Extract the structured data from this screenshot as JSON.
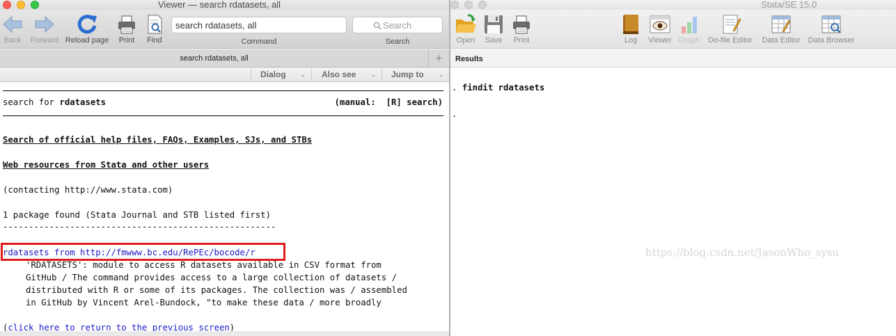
{
  "viewer": {
    "title": "Viewer — search rdatasets, all",
    "toolbar": {
      "back": "Back",
      "forward": "Forward",
      "reload": "Reload page",
      "print": "Print",
      "find": "Find",
      "command_value": "search rdatasets, all",
      "command_label": "Command",
      "search_placeholder": "Search",
      "search_label": "Search"
    },
    "tab": {
      "label": "search rdatasets, all",
      "add": "+"
    },
    "nav": {
      "dialog": "Dialog",
      "also_see": "Also see",
      "jump_to": "Jump to"
    },
    "content": {
      "search_for_prefix": "search for ",
      "search_term": "rdatasets",
      "manual_ref": "(manual:  [R] search)",
      "official_link": "Search of official help files, FAQs, Examples, SJs, and STBs",
      "web_link": "Web resources from Stata and other users",
      "contacting": "(contacting http://www.stata.com)",
      "found": "1 package found (Stata Journal and STB listed first)",
      "dashes": "-----------------------------------------------------",
      "package_link": "rdatasets from http://fmwww.bc.edu/RePEc/bocode/r",
      "desc": [
        "'RDATASETS': module to access R datasets available in CSV format from",
        "GitHub / The command provides access to a large collection of datasets /",
        "distributed with R or some of its packages. The collection was / assembled",
        "in GitHub by Vincent Arel-Bundock, \"to make these data / more broadly"
      ],
      "return_open": "(",
      "return_link": "click here to return to the previous screen",
      "return_close": ")"
    },
    "colors": {
      "link": "#1a19c6",
      "highlight_box": "#e01b1b"
    }
  },
  "stata": {
    "title": "Stata/SE 15.0",
    "toolbar": {
      "open": "Open",
      "save": "Save",
      "print": "Print",
      "log": "Log",
      "viewer": "Viewer",
      "graph": "Graph",
      "dofile": "Do-file Editor",
      "data_editor": "Data Editor",
      "data_browser": "Data Browser"
    },
    "results_label": "Results",
    "results": {
      "prompt": ". ",
      "command": "findit rdatasets",
      "prompt2": "."
    }
  },
  "watermark": "https://blog.csdn.net/JasonWho_sysu"
}
